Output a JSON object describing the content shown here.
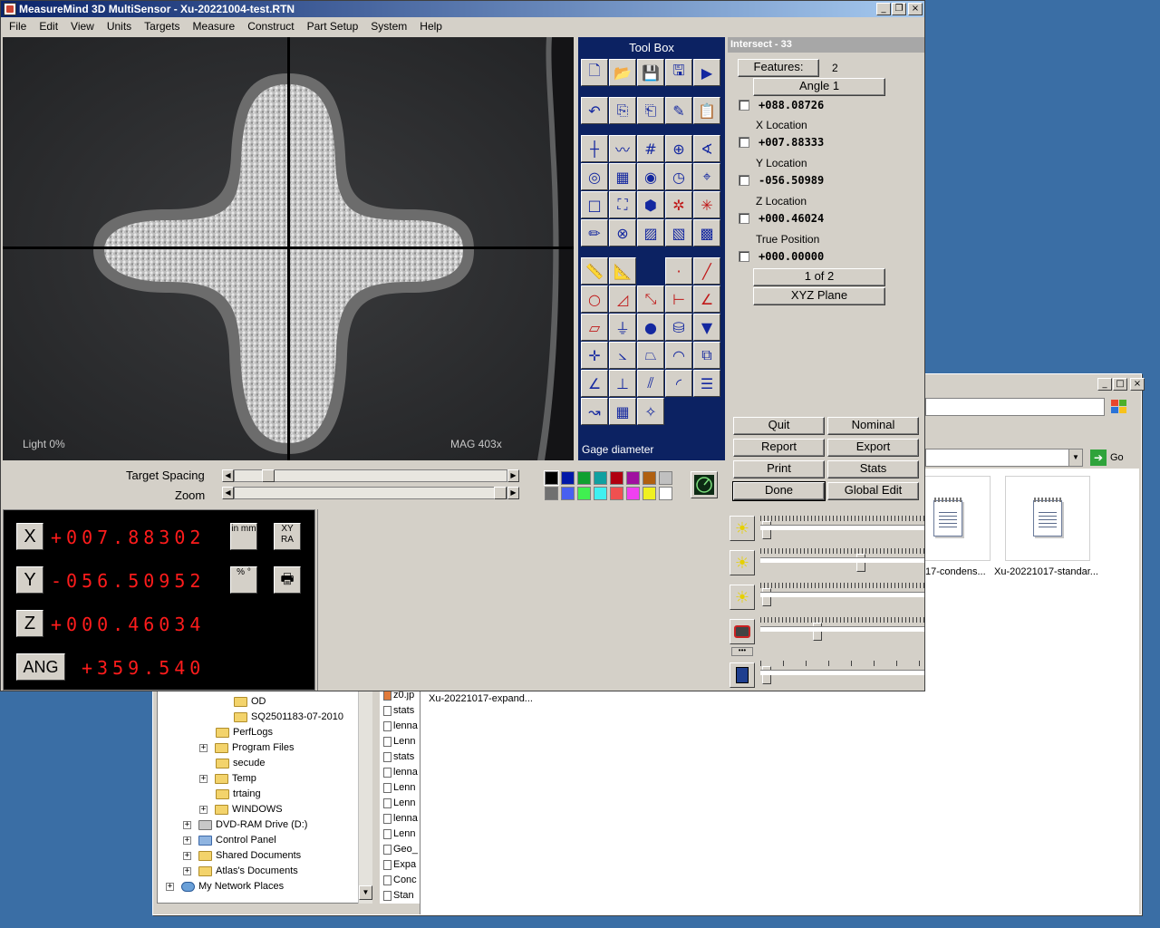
{
  "app": {
    "title": "MeasureMind 3D MultiSensor - Xu-20221004-test.RTN",
    "menu": [
      "File",
      "Edit",
      "View",
      "Units",
      "Targets",
      "Measure",
      "Construct",
      "Part Setup",
      "System",
      "Help"
    ]
  },
  "camera": {
    "light_label": "Light  0%",
    "mag_label": "MAG 403x"
  },
  "toolbox": {
    "title": "Tool Box",
    "status": "Gage diameter"
  },
  "feature_panel": {
    "title": "Intersect - 33",
    "features_button": "Features:",
    "features_count": "2",
    "angle_button": "Angle 1",
    "rows": [
      {
        "label": "",
        "value": "+088.08726"
      },
      {
        "label": "X Location",
        "value": "+007.88333"
      },
      {
        "label": "Y Location",
        "value": "-056.50989"
      },
      {
        "label": "Z Location",
        "value": "+000.46024"
      },
      {
        "label": "True Position",
        "value": "+000.00000"
      }
    ],
    "page_button": "1 of 2",
    "plane_button": "XYZ Plane",
    "buttons": {
      "quit": "Quit",
      "nominal": "Nominal",
      "report": "Report",
      "export": "Export",
      "print": "Print",
      "stats": "Stats",
      "done": "Done",
      "global_edit": "Global Edit"
    }
  },
  "sliders": {
    "target_spacing_label": "Target Spacing",
    "zoom_label": "Zoom"
  },
  "dro": {
    "x_label": "X",
    "x_value": "+007.88302",
    "y_label": "Y",
    "y_value": "-056.50952",
    "z_label": "Z",
    "z_value": "+000.46034",
    "ang_label": "ANG",
    "ang_value": "+359.540",
    "inmm_label": "in mm",
    "xyra_label": "XY RA",
    "pct_label": "% °"
  },
  "explorer": {
    "tree": [
      {
        "label": "OD",
        "indent": 3,
        "expander": false
      },
      {
        "label": "SQ2501183-07-2010",
        "indent": 3,
        "expander": false
      },
      {
        "label": "PerfLogs",
        "indent": 2,
        "expander": false
      },
      {
        "label": "Program Files",
        "indent": 2,
        "expander": true
      },
      {
        "label": "secude",
        "indent": 2,
        "expander": false
      },
      {
        "label": "Temp",
        "indent": 2,
        "expander": true
      },
      {
        "label": "trtaing",
        "indent": 2,
        "expander": false
      },
      {
        "label": "WINDOWS",
        "indent": 2,
        "expander": true
      },
      {
        "label": "DVD-RAM Drive (D:)",
        "indent": 1,
        "expander": true
      },
      {
        "label": "Control Panel",
        "indent": 1,
        "expander": true
      },
      {
        "label": "Shared Documents",
        "indent": 1,
        "expander": true
      },
      {
        "label": "Atlas's Documents",
        "indent": 1,
        "expander": true
      },
      {
        "label": "My Network Places",
        "indent": 0,
        "expander": true
      }
    ],
    "mid_files": [
      "z0.jp",
      "stats",
      "lenna",
      "Lenn",
      "stats",
      "lenna",
      "Lenn",
      "Lenn",
      "lenna",
      "Lenn",
      "Geo_",
      "Expa",
      "Conc",
      "Stan"
    ],
    "main_file": "Xu-20221017-expand...",
    "big_files": [
      "17-condens...",
      "Xu-20221017-standar..."
    ],
    "go_label": "Go"
  },
  "colors": {
    "title_start": "#0a246a",
    "title_end": "#a6caf0",
    "toolbox_bg": "#0c2262",
    "dro_digits": "#ff1c1c"
  }
}
